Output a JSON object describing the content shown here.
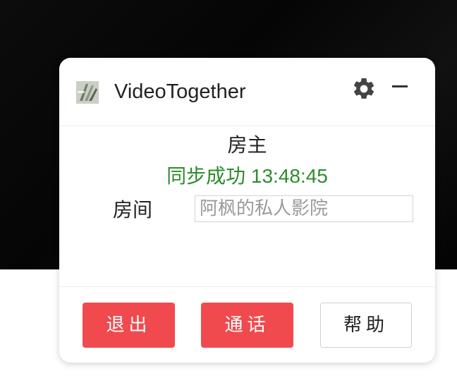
{
  "app": {
    "title": "VideoTogether"
  },
  "icons": {
    "logo": "app-logo-icon",
    "settings": "gear-icon",
    "minimize": "minimize-icon"
  },
  "status": {
    "role": "房主",
    "sync_message": "同步成功 13:48:45"
  },
  "room": {
    "label": "房间",
    "value": "",
    "placeholder": "阿枫的私人影院"
  },
  "buttons": {
    "exit_label": "退出",
    "call_label": "通话",
    "help_label": "帮助"
  },
  "colors": {
    "primary_button": "#f04a4f",
    "success_text": "#2e8b2e",
    "background_video": "#0a0a0a"
  }
}
